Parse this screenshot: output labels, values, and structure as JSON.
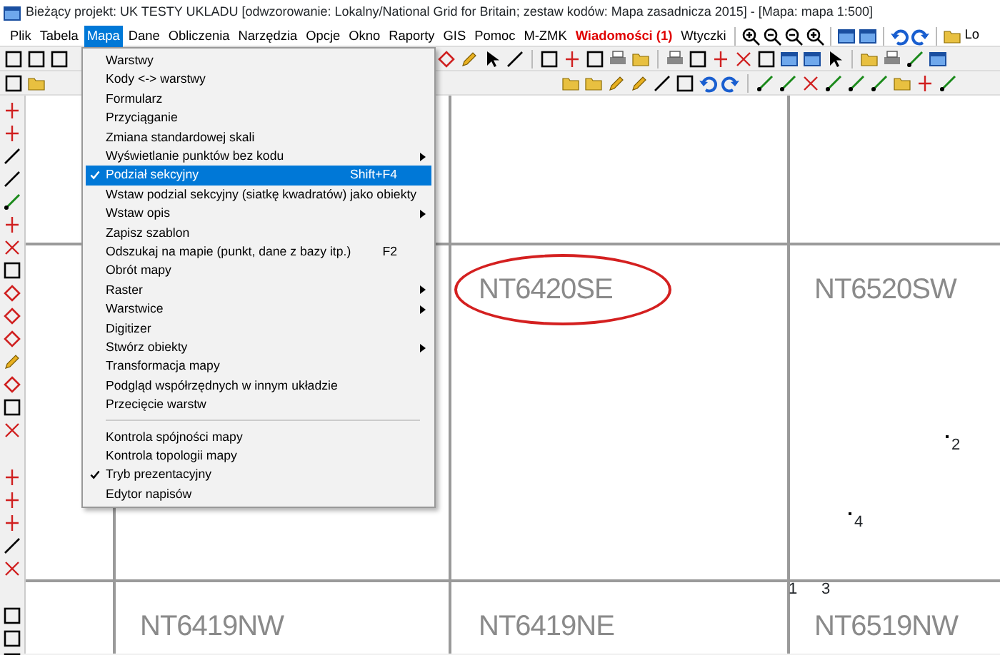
{
  "window": {
    "title": "Bieżący projekt: UK TESTY UKLADU [odwzorowanie: Lokalny/National Grid for Britain; zestaw kodów: Mapa zasadnicza 2015] - [Mapa: mapa  1:500]"
  },
  "menu_bar": [
    {
      "label": "Plik",
      "kind": "normal",
      "selected": false
    },
    {
      "label": "Tabela",
      "kind": "normal",
      "selected": false
    },
    {
      "label": "Mapa",
      "kind": "normal",
      "selected": true
    },
    {
      "label": "Dane",
      "kind": "normal",
      "selected": false
    },
    {
      "label": "Obliczenia",
      "kind": "normal",
      "selected": false
    },
    {
      "label": "Narzędzia",
      "kind": "normal",
      "selected": false
    },
    {
      "label": "Opcje",
      "kind": "normal",
      "selected": false
    },
    {
      "label": "Okno",
      "kind": "normal",
      "selected": false
    },
    {
      "label": "Raporty",
      "kind": "normal",
      "selected": false
    },
    {
      "label": "GIS",
      "kind": "normal",
      "selected": false
    },
    {
      "label": "Pomoc",
      "kind": "normal",
      "selected": false
    },
    {
      "label": "M-ZMK",
      "kind": "normal",
      "selected": false
    },
    {
      "label": "Wiadomości (1)",
      "kind": "alert",
      "selected": false
    },
    {
      "label": "Wtyczki",
      "kind": "normal",
      "selected": false
    }
  ],
  "toolbar_button": {
    "label": "Lo"
  },
  "dropdown": {
    "items": [
      {
        "kind": "item",
        "label": "Warstwy",
        "checked": false,
        "submenu": false,
        "selected": false
      },
      {
        "kind": "item",
        "label": "Kody <-> warstwy",
        "checked": false,
        "submenu": false,
        "selected": false
      },
      {
        "kind": "item",
        "label": "Formularz",
        "checked": false,
        "submenu": false,
        "selected": false
      },
      {
        "kind": "item",
        "label": "Przyciąganie",
        "checked": false,
        "submenu": false,
        "selected": false
      },
      {
        "kind": "item",
        "label": "Zmiana standardowej skali",
        "checked": false,
        "submenu": false,
        "selected": false
      },
      {
        "kind": "item",
        "label": "Wyświetlanie punktów bez kodu",
        "checked": false,
        "submenu": true,
        "selected": false
      },
      {
        "kind": "item",
        "label": "Podział sekcyjny",
        "shortcut": "Shift+F4",
        "checked": true,
        "submenu": false,
        "selected": true
      },
      {
        "kind": "item",
        "label": "Wstaw podzial sekcyjny (siatkę kwadratów) jako obiekty",
        "checked": false,
        "submenu": false,
        "selected": false
      },
      {
        "kind": "item",
        "label": "Wstaw opis",
        "checked": false,
        "submenu": true,
        "selected": false
      },
      {
        "kind": "item",
        "label": "Zapisz szablon",
        "checked": false,
        "submenu": false,
        "selected": false
      },
      {
        "kind": "item",
        "label": "Odszukaj na mapie (punkt, dane z bazy itp.)",
        "shortcut": "F2",
        "checked": false,
        "submenu": false,
        "selected": false
      },
      {
        "kind": "item",
        "label": "Obrót mapy",
        "checked": false,
        "submenu": false,
        "selected": false
      },
      {
        "kind": "item",
        "label": "Raster",
        "checked": false,
        "submenu": true,
        "selected": false
      },
      {
        "kind": "item",
        "label": "Warstwice",
        "checked": false,
        "submenu": true,
        "selected": false
      },
      {
        "kind": "item",
        "label": "Digitizer",
        "checked": false,
        "submenu": false,
        "selected": false
      },
      {
        "kind": "item",
        "label": "Stwórz obiekty",
        "checked": false,
        "submenu": true,
        "selected": false
      },
      {
        "kind": "item",
        "label": "Transformacja mapy",
        "checked": false,
        "submenu": false,
        "selected": false
      },
      {
        "kind": "item",
        "label": "Podgląd współrzędnych w innym układzie",
        "checked": false,
        "submenu": false,
        "selected": false
      },
      {
        "kind": "item",
        "label": "Przecięcie warstw",
        "checked": false,
        "submenu": false,
        "selected": false
      },
      {
        "kind": "separator"
      },
      {
        "kind": "item",
        "label": "Kontrola spójności mapy",
        "checked": false,
        "submenu": false,
        "selected": false
      },
      {
        "kind": "item",
        "label": "Kontrola topologii mapy",
        "checked": false,
        "submenu": false,
        "selected": false
      },
      {
        "kind": "item",
        "label": "Tryb prezentacyjny",
        "checked": true,
        "submenu": false,
        "selected": false
      },
      {
        "kind": "item",
        "label": "Edytor napisów",
        "checked": false,
        "submenu": false,
        "selected": false
      }
    ]
  },
  "map": {
    "sheets": [
      {
        "label": "NT6420SE",
        "circled": true
      },
      {
        "label": "NT6520SW",
        "circled": false
      },
      {
        "label": "NT6419NW",
        "circled": false
      },
      {
        "label": "NT6419NE",
        "circled": false
      },
      {
        "label": "NT6519NW",
        "circled": false
      }
    ],
    "points": [
      {
        "label": "2"
      },
      {
        "label": "4"
      },
      {
        "label": "1"
      },
      {
        "label": "3"
      }
    ]
  }
}
